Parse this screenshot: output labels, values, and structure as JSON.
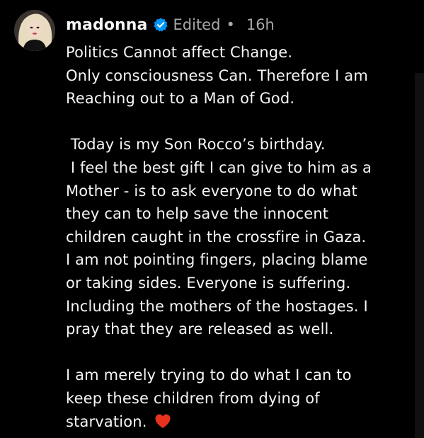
{
  "post": {
    "username": "madonna",
    "edited_label": "Edited",
    "separator": "•",
    "timestamp": "16h",
    "lines": [
      "Politics Cannot affect Change.",
      "Only consciousness Can. Therefore I am",
      "Reaching out to a Man of God.",
      "",
      " Today is my Son Rocco’s birthday.",
      " I feel the best gift I can give to him as a",
      "Mother - is to ask everyone to do what",
      "they can to help save the innocent",
      "children caught in the crossfire in Gaza.",
      "I am not pointing fingers, placing blame",
      "or taking sides. Everyone is suffering.",
      "Including the mothers of the hostages. I",
      "pray that they are released as well.",
      "",
      "I am merely trying to do what I can to",
      "keep these children from dying of"
    ],
    "last_line": "starvation. ",
    "icons": {
      "verified": "verified-badge-icon",
      "heart": "red-heart-icon"
    },
    "colors": {
      "background": "#000000",
      "text": "#f5f5f5",
      "muted": "#a8a8a8",
      "verified": "#0095f6",
      "heart": "#e8321e"
    }
  }
}
